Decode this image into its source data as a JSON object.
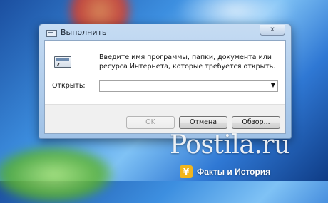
{
  "window": {
    "title": "Выполнить",
    "close_glyph": "x"
  },
  "content": {
    "description": "Введите имя программы, папки, документа или ресурса Интернета, которые требуется открыть.",
    "open_label": "Открыть:",
    "open_value": "",
    "open_arrow": "▼"
  },
  "buttons": {
    "ok": "OK",
    "cancel": "Отмена",
    "browse": "Обзор..."
  },
  "watermark": {
    "text": "Postila.ru",
    "brand": "Факты и История",
    "logo_glyph": "¥"
  }
}
